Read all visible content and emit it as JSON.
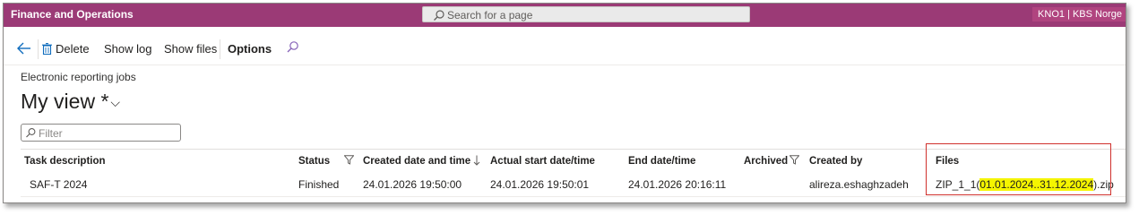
{
  "app": {
    "title": "Finance and Operations",
    "company": "KNO1 | KBS Norge"
  },
  "search": {
    "placeholder": "Search for a page"
  },
  "actions": {
    "delete_label": "Delete",
    "show_log_label": "Show log",
    "show_files_label": "Show files",
    "options_label": "Options"
  },
  "page": {
    "caption": "Electronic reporting jobs",
    "view_title": "My view *",
    "filter_placeholder": "Filter"
  },
  "grid": {
    "columns": {
      "task_description": "Task description",
      "status": "Status",
      "created": "Created date and time",
      "actual_start": "Actual start date/time",
      "end": "End date/time",
      "archived": "Archived",
      "created_by": "Created by",
      "files": "Files"
    },
    "rows": [
      {
        "task_description": "SAF-T 2024",
        "status": "Finished",
        "created": "24.01.2026 19:50:00",
        "actual_start": "24.01.2026 19:50:01",
        "end": "24.01.2026 20:16:11",
        "archived": "",
        "created_by": "alireza.eshaghzadeh",
        "files_prefix": "ZIP_1_1(",
        "files_highlight": "01.01.2024..31.12.2024",
        "files_suffix": ").zip"
      }
    ]
  },
  "colors": {
    "nav": "#9b3a76",
    "highlight": "#f5f500",
    "annotation": "#d0312d"
  }
}
